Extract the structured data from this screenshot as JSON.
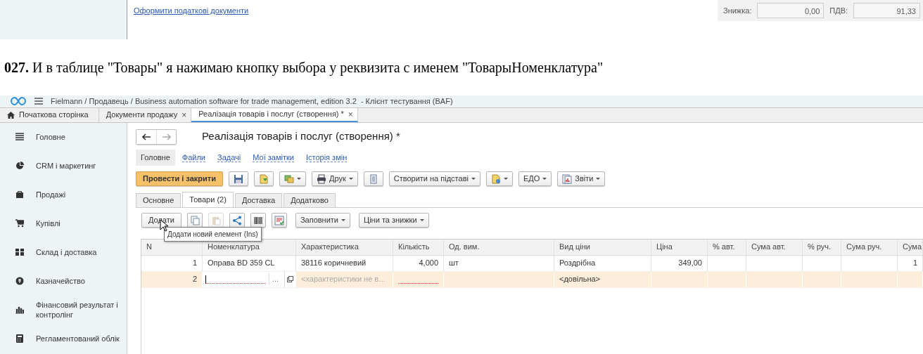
{
  "page_top": {
    "link": "Оформити податкові документи",
    "discount_label": "Знижка:",
    "discount_value": "0,00",
    "vat_label": "ПДВ:",
    "vat_value": "91,33"
  },
  "step": {
    "number": "027.",
    "text": "И в таблице \"Товары\" я нажимаю кнопку выбора у реквизита с именем \"ТоварыНоменклатура\""
  },
  "app": {
    "title": "Fielmann / Продавець / Business automation software for trade management, edition 3.2  - Клієнт тестування (BAF)",
    "tabs": [
      {
        "label": "Початкова сторінка",
        "kind": "home",
        "selected": false
      },
      {
        "label": "Документи продажу",
        "kind": "closable",
        "close": "×",
        "selected": false
      },
      {
        "label": "Реалізація товарів і послуг (створення) *",
        "kind": "closable",
        "close": "×",
        "selected": true
      }
    ],
    "sidebar": [
      {
        "label": "Головне"
      },
      {
        "label": "CRM і маркетинг"
      },
      {
        "label": "Продажі"
      },
      {
        "label": "Купівлі"
      },
      {
        "label": "Склад і доставка"
      },
      {
        "label": "Казначейство"
      },
      {
        "label": "Фінансовий результат і контролінг"
      },
      {
        "label": "Регламентований облік"
      }
    ],
    "form": {
      "title": "Реалізація товарів і послуг (створення) *",
      "nav": [
        {
          "label": "Головне",
          "selected": true
        },
        {
          "label": "Файли",
          "selected": false
        },
        {
          "label": "Задачі",
          "selected": false
        },
        {
          "label": "Мої замітки",
          "selected": false
        },
        {
          "label": "Історія змін",
          "selected": false
        }
      ],
      "toolbar": [
        {
          "kind": "primary",
          "label": "Провести і закрити"
        },
        {
          "kind": "icon"
        },
        {
          "kind": "icon"
        },
        {
          "kind": "icon_menu"
        },
        {
          "kind": "icon_menu",
          "label": "Друк"
        },
        {
          "kind": "icon"
        },
        {
          "kind": "menu",
          "label": "Створити на підставі"
        },
        {
          "kind": "icon_menu"
        },
        {
          "kind": "menu",
          "label": "ЕДО"
        },
        {
          "kind": "icon_menu",
          "label": "Звіти"
        }
      ],
      "tabs": [
        {
          "label": "Основне",
          "selected": false
        },
        {
          "label": "Товари (2)",
          "selected": true
        },
        {
          "label": "Доставка",
          "selected": false
        },
        {
          "label": "Додатково",
          "selected": false
        }
      ],
      "table_toolbar": [
        {
          "kind": "button",
          "label": "Додати",
          "disabled": false
        },
        {
          "kind": "icon",
          "disabled": false
        },
        {
          "kind": "icon",
          "disabled": true
        },
        {
          "kind": "icon",
          "disabled": false
        },
        {
          "kind": "icon",
          "disabled": false
        },
        {
          "kind": "icon",
          "disabled": false
        },
        {
          "kind": "menu",
          "label": "Заповнити",
          "disabled": false
        },
        {
          "kind": "menu",
          "label": "Ціни та знижки",
          "disabled": false
        }
      ],
      "tooltip": "Додати новий елемент (Ins)",
      "table": {
        "columns": [
          "N",
          "Номенклатура",
          "Характеристика",
          "Кількість",
          "Од. вим.",
          "Вид ціни",
          "Ціна",
          "% авт.",
          "Сума авт.",
          "% руч.",
          "Сума руч.",
          "Сума"
        ],
        "rows": [
          {
            "selected": false,
            "editing": false,
            "n": "1",
            "item": "Оправа BD 359 CL",
            "characteristic": "38116 коричневий",
            "quantity": "4,000",
            "unit": "шт",
            "price_type": "Роздрібна",
            "price": "349,00",
            "sum": "1"
          },
          {
            "selected": true,
            "editing": true,
            "n": "2",
            "choice_button": "...",
            "characteristic_placeholder": "<характеристики не в...",
            "price_type": "<довільна>"
          }
        ]
      }
    }
  }
}
